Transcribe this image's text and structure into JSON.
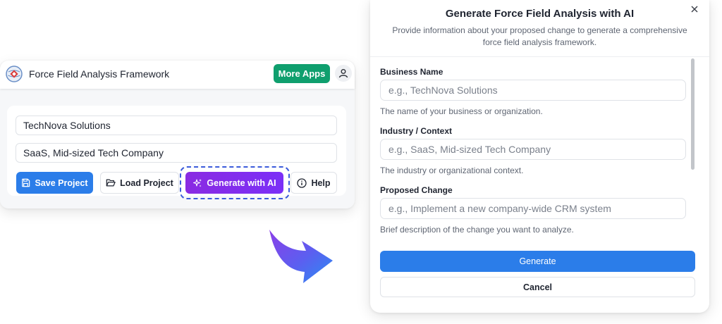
{
  "app": {
    "title": "Force Field Analysis Framework",
    "more_apps_label": "More Apps",
    "business_value": "TechNova Solutions",
    "industry_value": "SaaS, Mid-sized Tech Company",
    "buttons": {
      "save": "Save Project",
      "load": "Load Project",
      "generate": "Generate with AI",
      "help": "Help"
    },
    "icons": {
      "logo": "app-logo-icon",
      "user": "user-icon",
      "save": "save-icon",
      "load": "folder-open-icon",
      "generate": "sparkles-icon",
      "help": "info-icon"
    }
  },
  "modal": {
    "title": "Generate Force Field Analysis with AI",
    "description": "Provide information about your proposed change to generate a comprehensive force field analysis framework.",
    "close_icon": "close-icon",
    "fields": [
      {
        "label": "Business Name",
        "placeholder": "e.g., TechNova Solutions",
        "hint": "The name of your business or organization."
      },
      {
        "label": "Industry / Context",
        "placeholder": "e.g., SaaS, Mid-sized Tech Company",
        "hint": "The industry or organizational context."
      },
      {
        "label": "Proposed Change",
        "placeholder": "e.g., Implement a new company-wide CRM system",
        "hint": "Brief description of the change you want to analyze."
      }
    ],
    "generate_label": "Generate",
    "cancel_label": "Cancel"
  },
  "colors": {
    "primary_blue": "#2b7de9",
    "green": "#0f9f6e",
    "purple": "#8a2be2",
    "highlight": "#3b5bdb"
  }
}
